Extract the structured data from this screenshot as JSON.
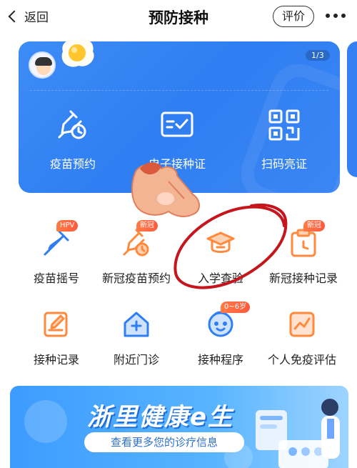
{
  "nav": {
    "back_label": "返回",
    "title": "预防接种",
    "rate_label": "评价"
  },
  "card": {
    "page_indicator": "1/3",
    "items": [
      {
        "label": "疫苗预约",
        "icon": "syringe-clock-icon"
      },
      {
        "label": "电子接种证",
        "icon": "certificate-check-icon"
      },
      {
        "label": "扫码亮证",
        "icon": "qr-code-icon"
      }
    ]
  },
  "grid": {
    "row1": [
      {
        "label": "疫苗摇号",
        "icon": "syringe-icon",
        "tag": "HPV"
      },
      {
        "label": "新冠疫苗预约",
        "icon": "syringe-clock-icon",
        "tag": "新冠"
      },
      {
        "label": "入学查验",
        "icon": "graduation-cap-icon",
        "tag": ""
      },
      {
        "label": "新冠接种记录",
        "icon": "clipboard-clock-icon",
        "tag": "新冠"
      }
    ],
    "row2": [
      {
        "label": "接种记录",
        "icon": "notebook-pen-icon",
        "tag": ""
      },
      {
        "label": "附近门诊",
        "icon": "clinic-house-icon",
        "tag": ""
      },
      {
        "label": "接种程序",
        "icon": "baby-face-icon",
        "tag": "0~6岁"
      },
      {
        "label": "个人免疫评估",
        "icon": "trend-chart-icon",
        "tag": ""
      }
    ]
  },
  "banner": {
    "title": "浙里健康e生",
    "subtitle": "查看更多您的诊疗信息"
  },
  "colors": {
    "blue": "#3583f3",
    "orange": "#ff8a3d",
    "icon_blue": "#2f7ef2",
    "annotation_red": "#c4161c"
  }
}
